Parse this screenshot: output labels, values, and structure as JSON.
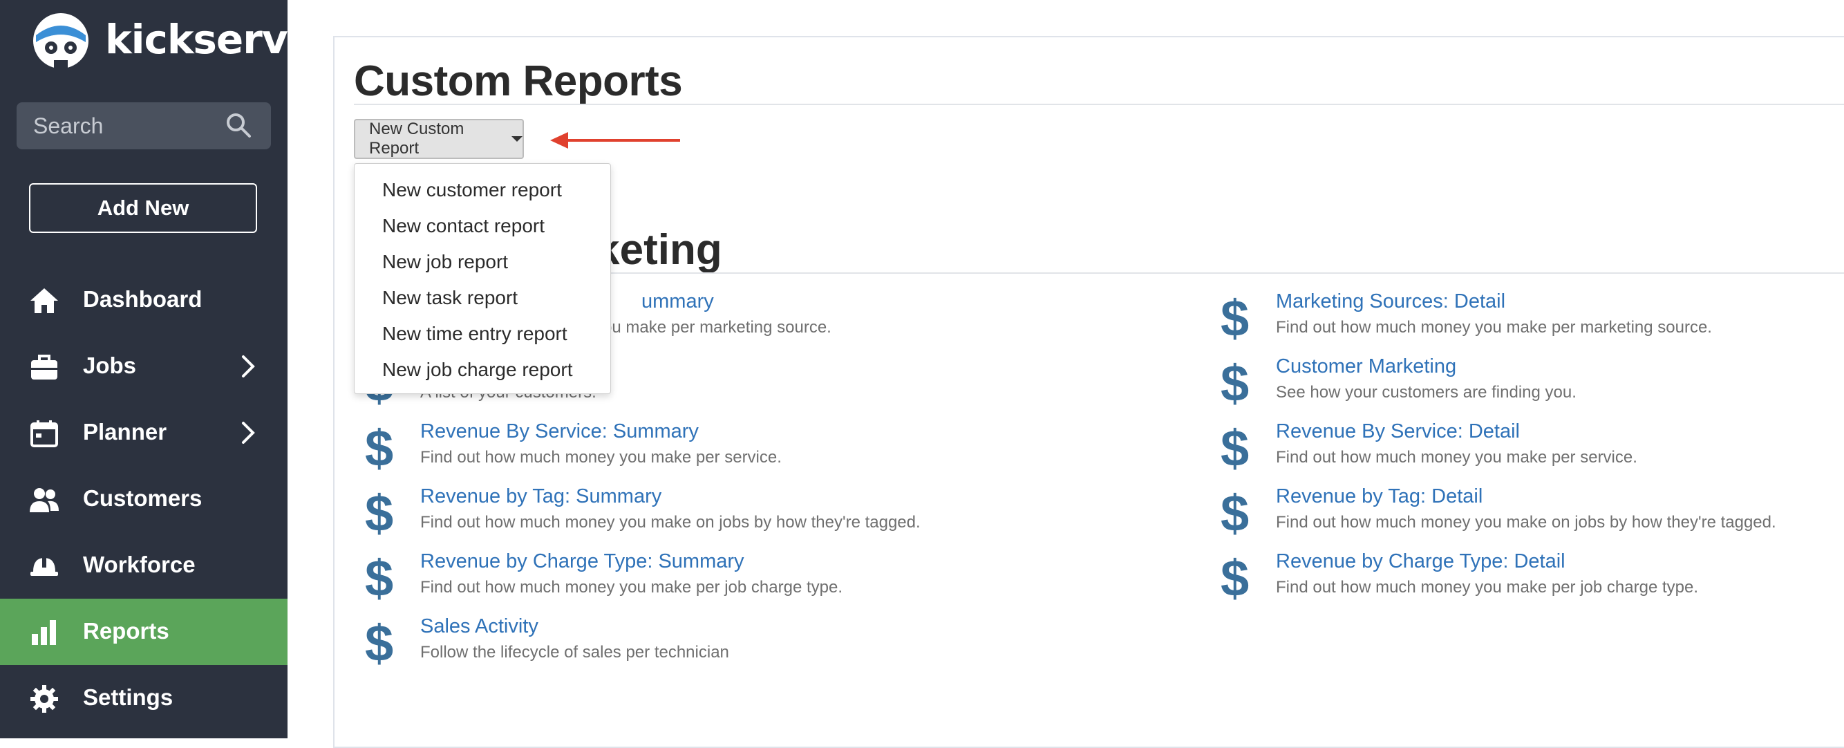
{
  "app": {
    "name": "kickserv"
  },
  "sidebar": {
    "search_placeholder": "Search",
    "add_new_label": "Add New",
    "items": [
      {
        "label": "Dashboard",
        "icon": "home-icon",
        "has_chevron": false,
        "active": false
      },
      {
        "label": "Jobs",
        "icon": "briefcase-icon",
        "has_chevron": true,
        "active": false
      },
      {
        "label": "Planner",
        "icon": "calendar-icon",
        "has_chevron": true,
        "active": false
      },
      {
        "label": "Customers",
        "icon": "people-icon",
        "has_chevron": false,
        "active": false
      },
      {
        "label": "Workforce",
        "icon": "hardhat-icon",
        "has_chevron": false,
        "active": false
      },
      {
        "label": "Reports",
        "icon": "bar-chart-icon",
        "has_chevron": false,
        "active": true
      },
      {
        "label": "Settings",
        "icon": "gear-icon",
        "has_chevron": false,
        "active": false
      }
    ]
  },
  "main": {
    "title": "Custom Reports",
    "new_custom_report_label": "New Custom Report",
    "dropdown_items": [
      "New customer report",
      "New contact report",
      "New job report",
      "New task report",
      "New time entry report",
      "New job charge report"
    ],
    "section_title_visible": "rketing",
    "reports_left": [
      {
        "title": "ummary",
        "desc": "ey you make per marketing source."
      },
      {
        "title": "",
        "desc": "A list of your customers."
      },
      {
        "title": "Revenue By Service: Summary",
        "desc": "Find out how much money you make per service."
      },
      {
        "title": "Revenue by Tag: Summary",
        "desc": "Find out how much money you make on jobs by how they're tagged."
      },
      {
        "title": "Revenue by Charge Type: Summary",
        "desc": "Find out how much money you make per job charge type."
      },
      {
        "title": "Sales Activity",
        "desc": "Follow the lifecycle of sales per technician"
      }
    ],
    "reports_right": [
      {
        "title": "Marketing Sources: Detail",
        "desc": "Find out how much money you make per marketing source."
      },
      {
        "title": "Customer Marketing",
        "desc": "See how your customers are finding you."
      },
      {
        "title": "Revenue By Service: Detail",
        "desc": "Find out how much money you make per service."
      },
      {
        "title": "Revenue by Tag: Detail",
        "desc": "Find out how much money you make on jobs by how they're tagged."
      },
      {
        "title": "Revenue by Charge Type: Detail",
        "desc": "Find out how much money you make per job charge type."
      }
    ],
    "report_icon": "dollar-icon"
  },
  "colors": {
    "sidebar_bg": "#2c323f",
    "active_nav": "#5ba55a",
    "link": "#2f72b8",
    "icon": "#3a6f9a",
    "annotation_arrow": "#e0412e"
  }
}
